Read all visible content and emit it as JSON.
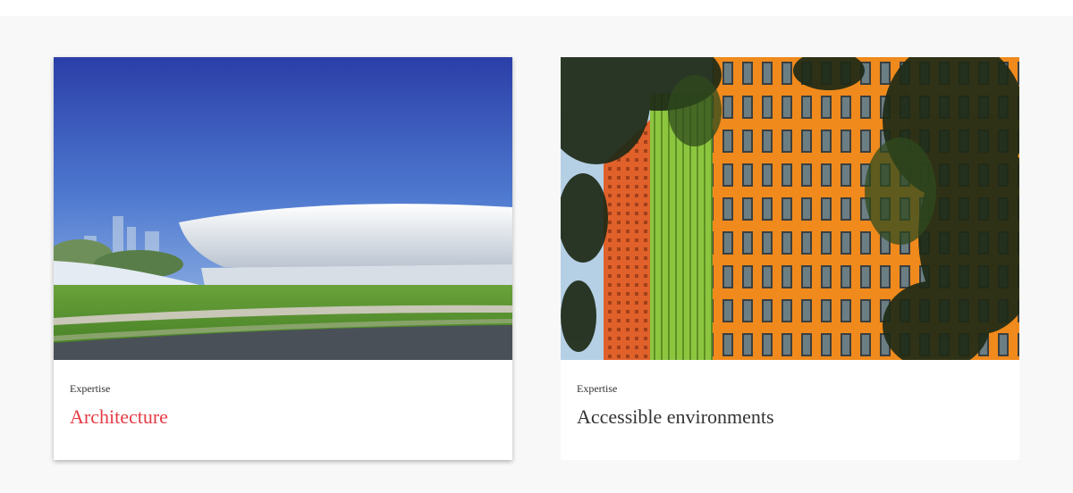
{
  "cards": [
    {
      "eyebrow": "Expertise",
      "title": "Architecture",
      "title_color": "#e63c46",
      "image_subject": "white disc-shaped stadium under blue sky with green lawn"
    },
    {
      "eyebrow": "Expertise",
      "title": "Accessible environments",
      "title_color": "#333333",
      "image_subject": "colorful orange and green building facade behind trees"
    }
  ]
}
